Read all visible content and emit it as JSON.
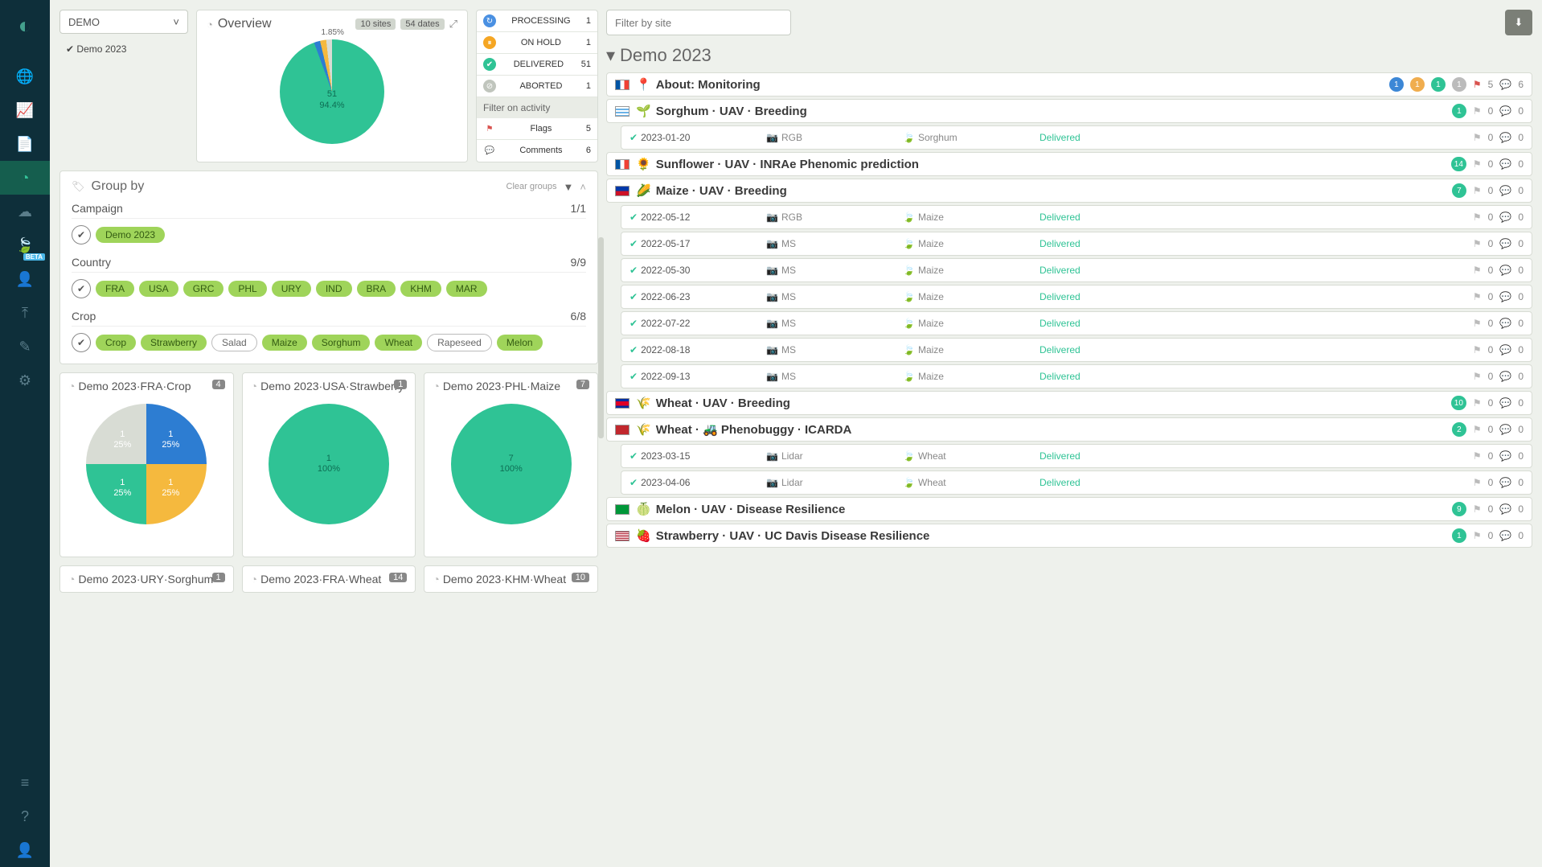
{
  "sidebar": {
    "beta_label": "BETA"
  },
  "campaign_select": {
    "value": "DEMO",
    "picked": "Demo 2023"
  },
  "overview": {
    "title": "Overview",
    "sites_badge": "10 sites",
    "dates_badge": "54 dates",
    "small_pct": "1.85%",
    "main_count": "51",
    "main_pct": "94.4%"
  },
  "status": {
    "rows": [
      {
        "label": "PROCESSING",
        "count": "1"
      },
      {
        "label": "ON HOLD",
        "count": "1"
      },
      {
        "label": "DELIVERED",
        "count": "51"
      },
      {
        "label": "ABORTED",
        "count": "1"
      }
    ],
    "activity_head": "Filter on activity",
    "flags": {
      "label": "Flags",
      "count": "5"
    },
    "comments": {
      "label": "Comments",
      "count": "6"
    }
  },
  "group": {
    "title": "Group by",
    "clear": "Clear groups",
    "campaign": {
      "label": "Campaign",
      "count": "1/1",
      "tags": [
        {
          "t": "Demo 2023",
          "on": true
        }
      ]
    },
    "country": {
      "label": "Country",
      "count": "9/9",
      "tags": [
        {
          "t": "FRA",
          "on": true
        },
        {
          "t": "USA",
          "on": true
        },
        {
          "t": "GRC",
          "on": true
        },
        {
          "t": "PHL",
          "on": true
        },
        {
          "t": "URY",
          "on": true
        },
        {
          "t": "IND",
          "on": true
        },
        {
          "t": "BRA",
          "on": true
        },
        {
          "t": "KHM",
          "on": true
        },
        {
          "t": "MAR",
          "on": true
        }
      ]
    },
    "crop": {
      "label": "Crop",
      "count": "6/8",
      "tags": [
        {
          "t": "Crop",
          "on": true
        },
        {
          "t": "Strawberry",
          "on": true
        },
        {
          "t": "Salad",
          "on": false
        },
        {
          "t": "Maize",
          "on": true
        },
        {
          "t": "Sorghum",
          "on": true
        },
        {
          "t": "Wheat",
          "on": true
        },
        {
          "t": "Rapeseed",
          "on": false
        },
        {
          "t": "Melon",
          "on": true
        }
      ]
    }
  },
  "mini": [
    {
      "title": "Demo 2023·FRA·Crop",
      "count": "4",
      "slices": [
        {
          "n": "1",
          "p": "25%",
          "c": "#2d7dd2"
        },
        {
          "n": "1",
          "p": "25%",
          "c": "#f5b93e"
        },
        {
          "n": "1",
          "p": "25%",
          "c": "#2fc395"
        },
        {
          "n": "1",
          "p": "25%",
          "c": "#d8dcd4"
        }
      ]
    },
    {
      "title": "Demo 2023·USA·Strawberry",
      "count": "1",
      "slices": [
        {
          "n": "1",
          "p": "100%",
          "c": "#2fc395"
        }
      ]
    },
    {
      "title": "Demo 2023·PHL·Maize",
      "count": "7",
      "slices": [
        {
          "n": "7",
          "p": "100%",
          "c": "#2fc395"
        }
      ]
    }
  ],
  "mini_bottom": [
    {
      "title": "Demo 2023·URY·Sorghum",
      "count": "1"
    },
    {
      "title": "Demo 2023·FRA·Wheat",
      "count": "14"
    },
    {
      "title": "Demo 2023·KHM·Wheat",
      "count": "10"
    }
  ],
  "filter": {
    "placeholder": "Filter by site"
  },
  "section": {
    "title": "Demo 2023"
  },
  "sites": [
    {
      "flag": "FR",
      "icon": "📍",
      "name": "About: Monitoring",
      "badges": [
        {
          "v": "1",
          "c": "blue"
        },
        {
          "v": "1",
          "c": "yel"
        },
        {
          "v": "1",
          "c": "green"
        },
        {
          "v": "1",
          "c": "grey"
        }
      ],
      "flagN": "5",
      "comN": "6",
      "flagRed": true
    },
    {
      "flag": "UY",
      "icon": "🌱",
      "name": "Sorghum · UAV · Breeding",
      "badges": [
        {
          "v": "1",
          "c": "green"
        }
      ],
      "flagN": "0",
      "comN": "0",
      "subs": [
        {
          "date": "2023-01-20",
          "sensor": "RGB",
          "crop": "Sorghum",
          "status": "Delivered",
          "f": "0",
          "c": "0"
        }
      ]
    },
    {
      "flag": "FR",
      "icon": "🌻",
      "name": "Sunflower · UAV · INRAe Phenomic prediction",
      "badges": [
        {
          "v": "14",
          "c": "green"
        }
      ],
      "flagN": "0",
      "comN": "0"
    },
    {
      "flag": "PH",
      "icon": "🌽",
      "name": "Maize · UAV · Breeding",
      "badges": [
        {
          "v": "7",
          "c": "green"
        }
      ],
      "flagN": "0",
      "comN": "0",
      "subs": [
        {
          "date": "2022-05-12",
          "sensor": "RGB",
          "crop": "Maize",
          "status": "Delivered",
          "f": "0",
          "c": "0"
        },
        {
          "date": "2022-05-17",
          "sensor": "MS",
          "crop": "Maize",
          "status": "Delivered",
          "f": "0",
          "c": "0"
        },
        {
          "date": "2022-05-30",
          "sensor": "MS",
          "crop": "Maize",
          "status": "Delivered",
          "f": "0",
          "c": "0"
        },
        {
          "date": "2022-06-23",
          "sensor": "MS",
          "crop": "Maize",
          "status": "Delivered",
          "f": "0",
          "c": "0"
        },
        {
          "date": "2022-07-22",
          "sensor": "MS",
          "crop": "Maize",
          "status": "Delivered",
          "f": "0",
          "c": "0"
        },
        {
          "date": "2022-08-18",
          "sensor": "MS",
          "crop": "Maize",
          "status": "Delivered",
          "f": "0",
          "c": "0"
        },
        {
          "date": "2022-09-13",
          "sensor": "MS",
          "crop": "Maize",
          "status": "Delivered",
          "f": "0",
          "c": "0"
        }
      ]
    },
    {
      "flag": "KH",
      "icon": "🌾",
      "name": "Wheat · UAV · Breeding",
      "badges": [
        {
          "v": "10",
          "c": "green"
        }
      ],
      "flagN": "0",
      "comN": "0"
    },
    {
      "flag": "MA",
      "icon": "🌾",
      "name": "Wheat · 🚜 Phenobuggy · ICARDA",
      "badges": [
        {
          "v": "2",
          "c": "green"
        }
      ],
      "flagN": "0",
      "comN": "0",
      "subs": [
        {
          "date": "2023-03-15",
          "sensor": "Lidar",
          "crop": "Wheat",
          "status": "Delivered",
          "f": "0",
          "c": "0"
        },
        {
          "date": "2023-04-06",
          "sensor": "Lidar",
          "crop": "Wheat",
          "status": "Delivered",
          "f": "0",
          "c": "0"
        }
      ]
    },
    {
      "flag": "BR",
      "icon": "🍈",
      "name": "Melon · UAV · Disease Resilience",
      "badges": [
        {
          "v": "9",
          "c": "green"
        }
      ],
      "flagN": "0",
      "comN": "0"
    },
    {
      "flag": "US",
      "icon": "🍓",
      "name": "Strawberry · UAV · UC Davis Disease Resilience",
      "badges": [
        {
          "v": "1",
          "c": "green"
        }
      ],
      "flagN": "0",
      "comN": "0"
    }
  ],
  "chart_data": {
    "overview": {
      "type": "pie",
      "title": "Overview",
      "slices": [
        {
          "label": "Delivered",
          "value": 51,
          "pct": 94.4,
          "color": "#2fc395"
        },
        {
          "label": "Processing",
          "value": 1,
          "pct": 1.85,
          "color": "#2d7dd2"
        },
        {
          "label": "On hold",
          "value": 1,
          "pct": 1.85,
          "color": "#f5b93e"
        },
        {
          "label": "Aborted",
          "value": 1,
          "pct": 1.85,
          "color": "#d8dcd4"
        }
      ]
    },
    "mini": [
      {
        "type": "pie",
        "title": "Demo 2023·FRA·Crop",
        "slices": [
          {
            "value": 1,
            "pct": 25,
            "color": "#2d7dd2"
          },
          {
            "value": 1,
            "pct": 25,
            "color": "#f5b93e"
          },
          {
            "value": 1,
            "pct": 25,
            "color": "#2fc395"
          },
          {
            "value": 1,
            "pct": 25,
            "color": "#d8dcd4"
          }
        ]
      },
      {
        "type": "pie",
        "title": "Demo 2023·USA·Strawberry",
        "slices": [
          {
            "value": 1,
            "pct": 100,
            "color": "#2fc395"
          }
        ]
      },
      {
        "type": "pie",
        "title": "Demo 2023·PHL·Maize",
        "slices": [
          {
            "value": 7,
            "pct": 100,
            "color": "#2fc395"
          }
        ]
      }
    ]
  }
}
